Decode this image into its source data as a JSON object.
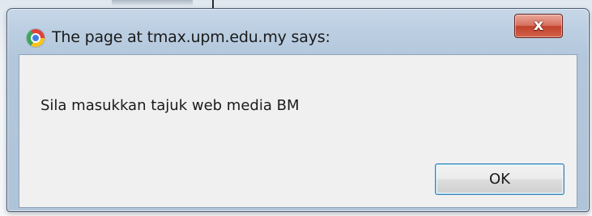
{
  "dialog": {
    "title": "The page at tmax.upm.edu.my says:",
    "close_label": "x",
    "message": "Sila masukkan tajuk web media BM",
    "ok_label": "OK",
    "app_icon": "chrome-icon",
    "close_icon": "close-icon"
  },
  "colors": {
    "frame": "#b3c7dc",
    "content_background": "#f0f0f0",
    "close_button": "#c1422c",
    "ok_button_focus": "#3c7fb1"
  }
}
